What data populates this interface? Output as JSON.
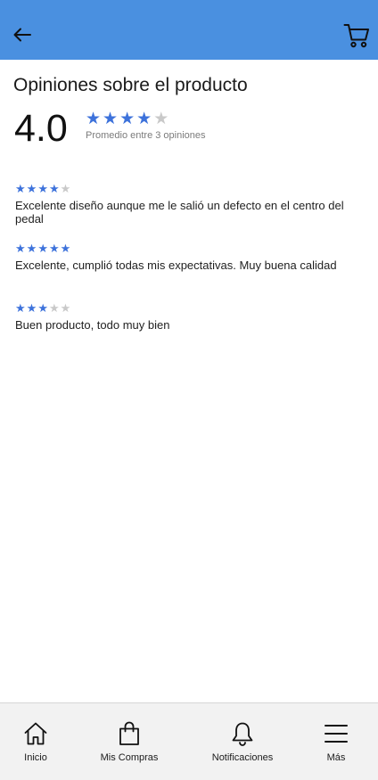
{
  "header": {
    "background_color": "#4a90e0",
    "back_icon": "arrow-left-icon",
    "cart_icon": "cart-icon"
  },
  "page": {
    "title": "Opiniones sobre el producto",
    "average_score": "4.0",
    "average_rating": 4,
    "max_rating": 5,
    "average_caption": "Promedio entre 3 opiniones"
  },
  "colors": {
    "star_on": "#3d72db",
    "star_off": "#c9c9c9"
  },
  "reviews": [
    {
      "rating": 4,
      "text": "Excelente diseño aunque me le salió un defecto en el centro del pedal"
    },
    {
      "rating": 5,
      "text": "Excelente, cumplió todas mis expectativas. Muy buena calidad"
    },
    {
      "rating": 3,
      "text": "Buen producto, todo muy bien"
    }
  ],
  "bottom_nav": {
    "items": [
      {
        "label": "Inicio",
        "icon": "home-icon"
      },
      {
        "label": "Mis Compras",
        "icon": "shopping-bag-icon"
      },
      {
        "label": "Notificaciones",
        "icon": "bell-icon"
      },
      {
        "label": "Más",
        "icon": "menu-icon"
      }
    ]
  }
}
